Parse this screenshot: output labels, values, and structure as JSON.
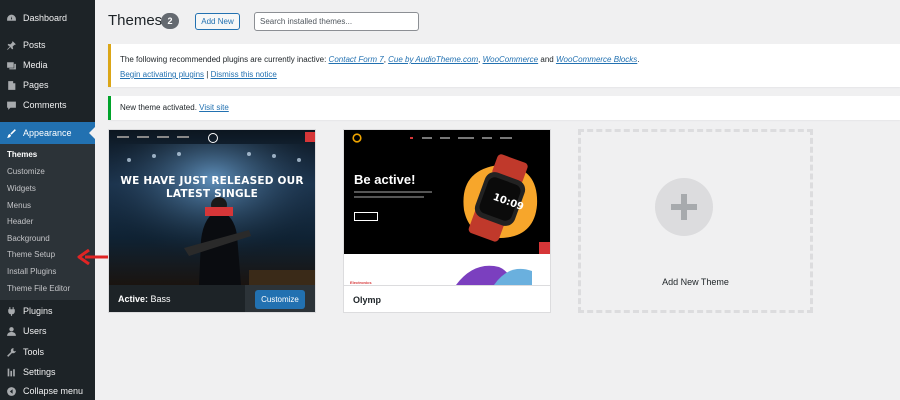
{
  "sidebar": {
    "items": [
      {
        "label": "Dashboard",
        "icon": "dashboard-icon"
      },
      {
        "label": "Posts",
        "icon": "pin-icon"
      },
      {
        "label": "Media",
        "icon": "media-icon"
      },
      {
        "label": "Pages",
        "icon": "pages-icon"
      },
      {
        "label": "Comments",
        "icon": "comments-icon"
      },
      {
        "label": "Appearance",
        "icon": "paintbrush-icon"
      },
      {
        "label": "Plugins",
        "icon": "plugins-icon"
      },
      {
        "label": "Users",
        "icon": "users-icon"
      },
      {
        "label": "Tools",
        "icon": "tools-icon"
      },
      {
        "label": "Settings",
        "icon": "settings-icon"
      },
      {
        "label": "Collapse menu",
        "icon": "collapse-icon"
      }
    ],
    "submenu": [
      "Themes",
      "Customize",
      "Widgets",
      "Menus",
      "Header",
      "Background",
      "Theme Setup",
      "Install Plugins",
      "Theme File Editor"
    ],
    "active_color": "#2271b1",
    "background": "#1d2327"
  },
  "header": {
    "title": "Themes",
    "count": "2",
    "add_new_label": "Add New",
    "search_placeholder": "Search installed themes..."
  },
  "notices": {
    "plugins": {
      "text_before": "The following recommended plugins are currently inactive: ",
      "plugin_1": "Contact Form 7",
      "sep_1": ", ",
      "plugin_2": "Cue by AudioTheme.com",
      "sep_2": ", ",
      "plugin_3": "WooCommerce",
      "sep_3": " and ",
      "plugin_4": "WooCommerce Blocks",
      "end": ".",
      "link_begin": "Begin activating plugins",
      "divider": " | ",
      "link_dismiss": "Dismiss this notice"
    },
    "activated": {
      "text": "New theme activated. ",
      "link": "Visit site"
    }
  },
  "themes": {
    "bass": {
      "active_prefix": "Active:",
      "name": " Bass",
      "customize_label": "Customize",
      "headline_1": "WE HAVE JUST RELEASED OUR",
      "headline_2": "LATEST SINGLE"
    },
    "olymp": {
      "name": "Olymp",
      "hero_title": "Be active!",
      "bottom_label": "Electronics"
    },
    "add_new": "Add New Theme"
  }
}
